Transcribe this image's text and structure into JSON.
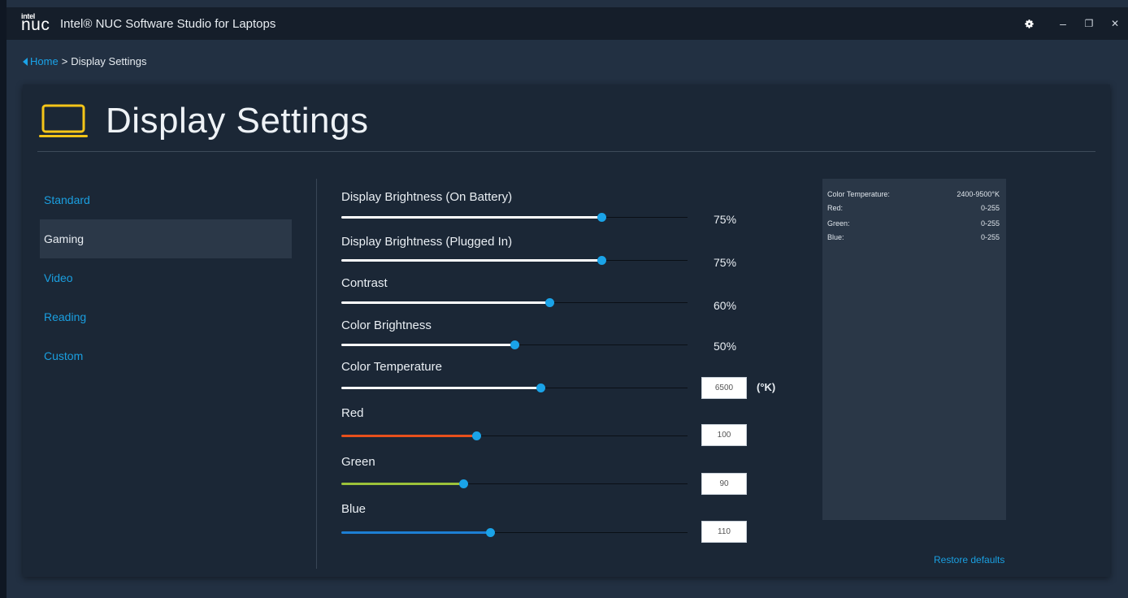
{
  "app": {
    "logo_small": "intel",
    "logo_large": "nuc",
    "title": "Intel® NUC Software Studio for Laptops",
    "controls": {
      "minimize": "–",
      "restore": "❐",
      "close": "✕"
    },
    "icons": [
      "gear-icon",
      "minimize-icon",
      "restore-icon",
      "close-icon"
    ]
  },
  "breadcrumb": {
    "home": "Home",
    "separator": ">",
    "current": "Display Settings"
  },
  "page": {
    "title": "Display Settings",
    "icon": "laptop-icon",
    "accent_color": "#f5c518"
  },
  "sidebar": {
    "items": [
      {
        "label": "Standard",
        "active": false
      },
      {
        "label": "Gaming",
        "active": true
      },
      {
        "label": "Video",
        "active": false
      },
      {
        "label": "Reading",
        "active": false
      },
      {
        "label": "Custom",
        "active": false
      }
    ]
  },
  "sliders": [
    {
      "label": "Display Brightness (On Battery)",
      "value": "75%",
      "fraction": 0.75,
      "color": "#ffffff"
    },
    {
      "label": "Display Brightness (Plugged In)",
      "value": "75%",
      "fraction": 0.75,
      "color": "#ffffff"
    },
    {
      "label": "Contrast",
      "value": "60%",
      "fraction": 0.6,
      "color": "#ffffff"
    },
    {
      "label": "Color Brightness",
      "value": "50%",
      "fraction": 0.5,
      "color": "#ffffff"
    },
    {
      "label": "Color Temperature",
      "value": "6500",
      "unit": "(°K)",
      "fraction": 0.576,
      "color": "#ffffff"
    },
    {
      "label": "Red",
      "value": "100",
      "fraction": 0.39,
      "color": "#e8501c"
    },
    {
      "label": "Green",
      "value": "90",
      "fraction": 0.353,
      "color": "#9cc23a"
    },
    {
      "label": "Blue",
      "value": "110",
      "fraction": 0.43,
      "color": "#1d7fd4"
    }
  ],
  "ranges": [
    {
      "label": "Color Temperature:",
      "range": "2400-9500°K"
    },
    {
      "label": "Red:",
      "range": "0-255"
    },
    {
      "label": "Green:",
      "range": "0-255"
    },
    {
      "label": "Blue:",
      "range": "0-255"
    }
  ],
  "restore_defaults": "Restore defaults",
  "colors": {
    "link": "#1aa3e8",
    "panel": "#1b2736",
    "background": "#223042"
  }
}
